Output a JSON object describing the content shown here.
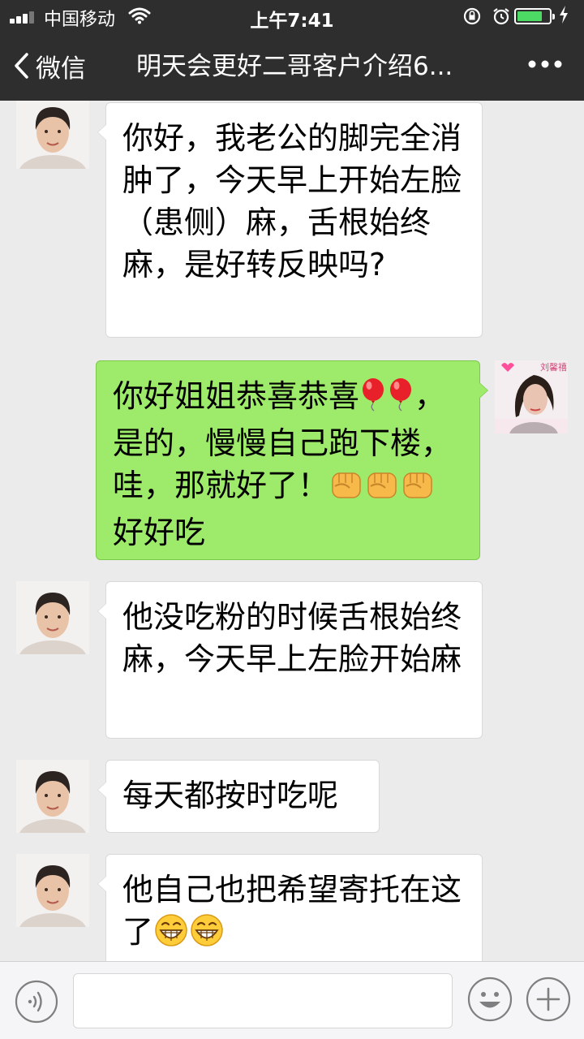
{
  "status_bar": {
    "carrier": "中国移动",
    "time": "上午7:41",
    "battery_level": 0.8
  },
  "nav": {
    "back_label": "微信",
    "title": "明天会更好二哥客户介绍6..."
  },
  "messages": [
    {
      "side": "in",
      "text": "你好，我老公的脚完全消肿了，今天早上开始左脸（患侧）麻，舌根始终麻，是好转反映吗?"
    },
    {
      "side": "out",
      "text_part1": "你好姐姐恭喜恭喜",
      "text_part2": "，是的，慢慢自己跑下楼，哇，那就好了！",
      "text_part3": "好好吃",
      "avatar_label": "刘馨禧",
      "emoji": [
        "balloon",
        "balloon",
        "fist",
        "fist",
        "fist"
      ]
    },
    {
      "side": "in",
      "text": "他没吃粉的时候舌根始终麻，今天早上左脸开始麻"
    },
    {
      "side": "in",
      "text": "每天都按时吃呢"
    },
    {
      "side": "in",
      "text": "他自己也把希望寄托在这了",
      "emoji": [
        "grin",
        "grin"
      ]
    }
  ],
  "colors": {
    "header_bg": "#2e2e2e",
    "chat_bg": "#ebebeb",
    "outgoing_bubble": "#9eea6a",
    "incoming_bubble": "#ffffff"
  },
  "icons": [
    "chevron-left-icon",
    "more-icon",
    "voice-icon",
    "emoji-icon",
    "plus-icon",
    "wifi-icon",
    "battery-icon"
  ]
}
